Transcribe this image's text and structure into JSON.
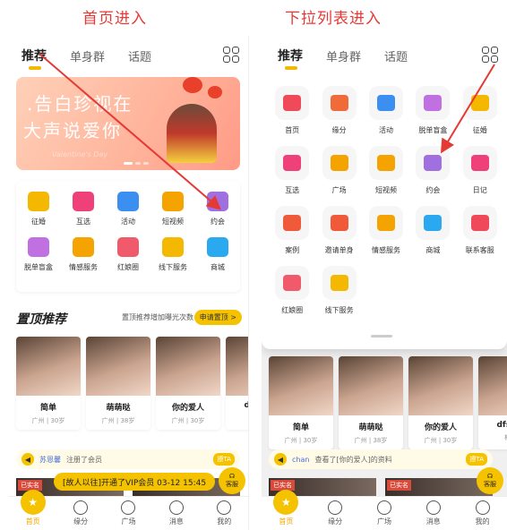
{
  "captions": {
    "left": "首页进入",
    "right": "下拉列表进入"
  },
  "tabs": [
    {
      "label": "推荐"
    },
    {
      "label": "单身群"
    },
    {
      "label": "话题"
    }
  ],
  "banner": {
    "line1": ".告白珍视在",
    "line2": "大声说爱你",
    "sub": "Valentine's Day"
  },
  "menu": [
    [
      {
        "label": "征婚",
        "icon": "marriage-icon",
        "color": "#f5b800"
      },
      {
        "label": "互选",
        "icon": "heart-icon",
        "color": "#f0407a"
      },
      {
        "label": "活动",
        "icon": "balloon-icon",
        "color": "#3a8ff0"
      },
      {
        "label": "短视频",
        "icon": "video-icon",
        "color": "#f5a300"
      },
      {
        "label": "约会",
        "icon": "wine-glass-icon",
        "color": "#a070e0"
      }
    ],
    [
      {
        "label": "脱单盲盒",
        "icon": "blindbox-icon",
        "color": "#c070e0"
      },
      {
        "label": "情感服务",
        "icon": "counselor-icon",
        "color": "#f5a300"
      },
      {
        "label": "红娘圈",
        "icon": "matchmaker-icon",
        "color": "#f05a6a"
      },
      {
        "label": "线下服务",
        "icon": "offline-icon",
        "color": "#f5b800"
      },
      {
        "label": "商城",
        "icon": "shop-icon",
        "color": "#2aa8f0"
      }
    ]
  ],
  "section": {
    "title": "置顶推荐",
    "hint": "置顶推荐增加曝光次数",
    "button": "申请置顶 >"
  },
  "cards": [
    {
      "name": "简单",
      "meta": "广州 | 30岁"
    },
    {
      "name": "萌萌哒",
      "meta": "广州 | 38岁"
    },
    {
      "name": "你的爱人",
      "meta": "广州 | 30岁"
    },
    {
      "name": "dfsafs",
      "meta": "柳州"
    }
  ],
  "notice_left": {
    "user": "苏恩馨",
    "action": "注册了会员",
    "button": "撩TA"
  },
  "notice_right": {
    "user": "chan",
    "action": "查看了[你的爱人]的资料",
    "button": "撩TA"
  },
  "vip_banner": "[故人以往]开通了VIP会员 03-12 15:45",
  "report": "客服",
  "tag": "已实名",
  "tabbar": [
    {
      "label": "首页"
    },
    {
      "label": "缘分"
    },
    {
      "label": "广场"
    },
    {
      "label": "消息"
    },
    {
      "label": "我的"
    }
  ],
  "dropdown": [
    {
      "label": "首页",
      "color": "#f04a5a"
    },
    {
      "label": "缘分",
      "color": "#f06a3a"
    },
    {
      "label": "活动",
      "color": "#3a8ff0"
    },
    {
      "label": "脱单盲盒",
      "color": "#c070e0"
    },
    {
      "label": "征婚",
      "color": "#f5b800"
    },
    {
      "label": "互选",
      "color": "#f0407a"
    },
    {
      "label": "广场",
      "color": "#f5a300"
    },
    {
      "label": "短视频",
      "color": "#f5a300"
    },
    {
      "label": "约会",
      "color": "#a070e0"
    },
    {
      "label": "日记",
      "color": "#f0407a"
    },
    {
      "label": "案例",
      "color": "#f05a3a"
    },
    {
      "label": "邀请单身",
      "color": "#f05a3a"
    },
    {
      "label": "情感服务",
      "color": "#f5a300"
    },
    {
      "label": "商城",
      "color": "#2aa8f0"
    },
    {
      "label": "联系客服",
      "color": "#f04a5a"
    },
    {
      "label": "红娘圈",
      "color": "#f05a6a"
    },
    {
      "label": "线下服务",
      "color": "#f5b800"
    }
  ]
}
